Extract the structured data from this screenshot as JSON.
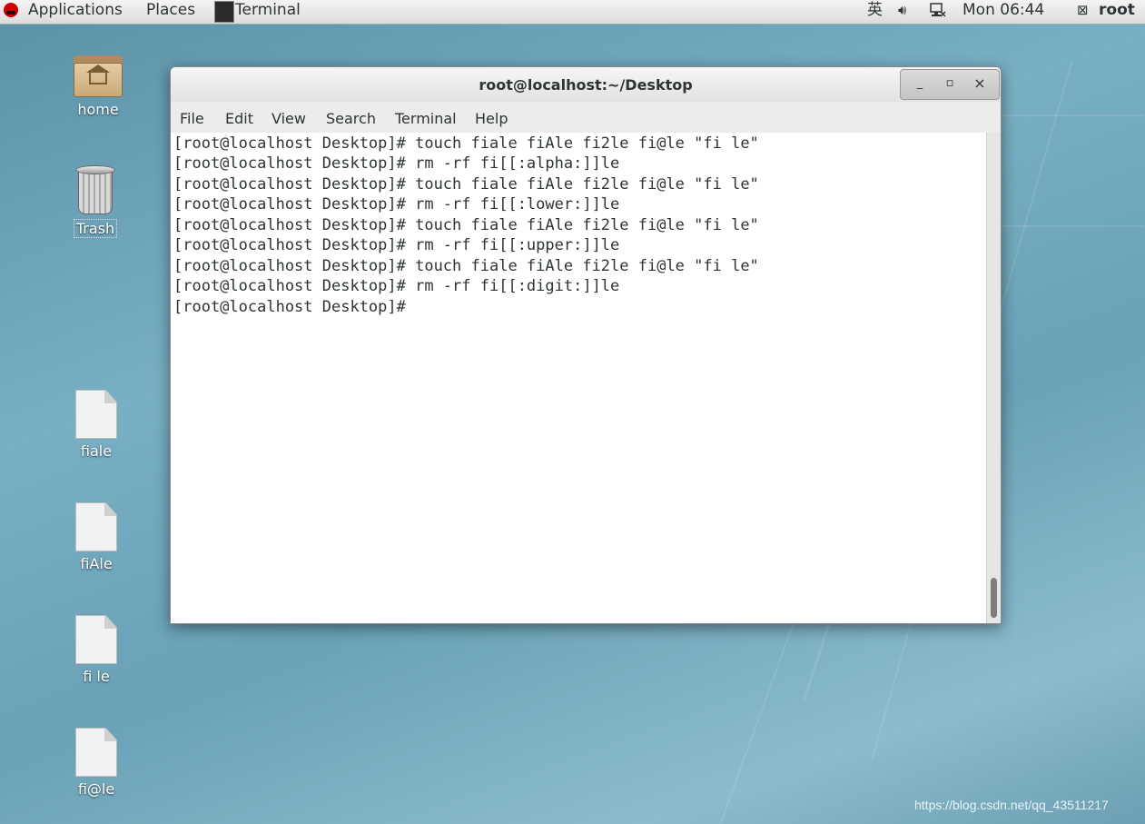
{
  "topbar": {
    "applications": "Applications",
    "places": "Places",
    "task_label": "Terminal",
    "ime": "英",
    "clock": "Mon 06:44",
    "user": "root",
    "icons": [
      "redhat-icon",
      "terminal-icon",
      "volume-icon",
      "network-icon",
      "user-icon"
    ]
  },
  "desktop": {
    "icons": [
      {
        "label": "home",
        "icon": "home-folder-icon"
      },
      {
        "label": "Trash",
        "icon": "trash-icon"
      },
      {
        "label": "fiale",
        "icon": "file-icon"
      },
      {
        "label": "fiAle",
        "icon": "file-icon"
      },
      {
        "label": "fi le",
        "icon": "file-icon"
      },
      {
        "label": "fi@le",
        "icon": "file-icon"
      }
    ]
  },
  "window": {
    "title": "root@localhost:~/Desktop",
    "buttons": {
      "minimize": "_",
      "maximize": "▫",
      "close": "×"
    },
    "menus": [
      "File",
      "Edit",
      "View",
      "Search",
      "Terminal",
      "Help"
    ],
    "lines": [
      "[root@localhost Desktop]# touch fiale fiAle fi2le fi@le \"fi le\"",
      "[root@localhost Desktop]# rm -rf fi[[:alpha:]]le",
      "[root@localhost Desktop]# touch fiale fiAle fi2le fi@le \"fi le\"",
      "[root@localhost Desktop]# rm -rf fi[[:lower:]]le",
      "[root@localhost Desktop]# touch fiale fiAle fi2le fi@le \"fi le\"",
      "[root@localhost Desktop]# rm -rf fi[[:upper:]]le",
      "[root@localhost Desktop]# touch fiale fiAle fi2le fi@le \"fi le\"",
      "[root@localhost Desktop]# rm -rf fi[[:digit:]]le",
      "[root@localhost Desktop]#"
    ]
  },
  "watermark": "https://blog.csdn.net/qq_43511217"
}
